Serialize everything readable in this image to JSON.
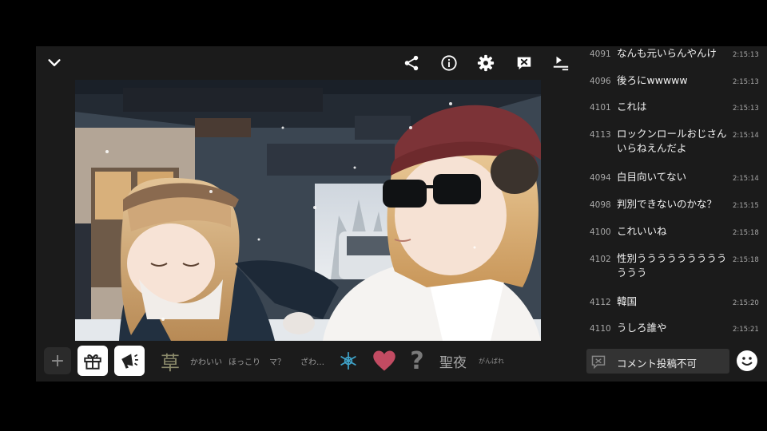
{
  "toolbar": {
    "icons": [
      "chevron-down-icon",
      "share-icon",
      "info-icon",
      "gear-icon",
      "comment-off-icon",
      "queue-icon"
    ]
  },
  "reactions": {
    "items": [
      {
        "label": "草"
      },
      {
        "label": "かわいい"
      },
      {
        "label": "ほっこり"
      },
      {
        "label": "マ？"
      },
      {
        "label": "ざわ…"
      },
      {
        "label": "聖夜"
      },
      {
        "label": "がんばれ"
      }
    ],
    "plus": "+",
    "question": "?"
  },
  "comments": [
    {
      "no": "4091",
      "text": "なんも元いらんやんけ",
      "time": "2:15:13"
    },
    {
      "no": "4096",
      "text": "後ろにwwwww",
      "time": "2:15:13"
    },
    {
      "no": "4101",
      "text": "これは",
      "time": "2:15:13"
    },
    {
      "no": "4113",
      "text": "ロックンロールおじさんいらねえんだよ",
      "time": "2:15:14"
    },
    {
      "no": "4094",
      "text": "白目向いてない",
      "time": "2:15:14"
    },
    {
      "no": "4098",
      "text": "判別できないのかな？",
      "time": "2:15:15"
    },
    {
      "no": "4100",
      "text": "これいいね",
      "time": "2:15:18"
    },
    {
      "no": "4102",
      "text": "性別うううううううううううう",
      "time": "2:15:18"
    },
    {
      "no": "4112",
      "text": "韓国",
      "time": "2:15:20"
    },
    {
      "no": "4110",
      "text": "うしろ誰や",
      "time": "2:15:21"
    }
  ],
  "post": {
    "label": "コメント投稿不可"
  },
  "colors": {
    "background": "#1b1b1b",
    "heart": "#c24b62",
    "snowflake": "#3fa3c9",
    "reaction_text": "#9a9a9a"
  }
}
